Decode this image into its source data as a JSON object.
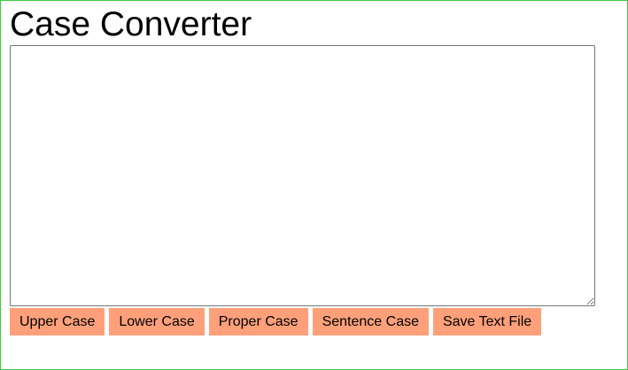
{
  "page": {
    "title": "Case Converter"
  },
  "editor": {
    "value": ""
  },
  "buttons": {
    "upper_case": "Upper Case",
    "lower_case": "Lower Case",
    "proper_case": "Proper Case",
    "sentence_case": "Sentence Case",
    "save_text_file": "Save Text File"
  },
  "colors": {
    "frame_border": "#3ec93e",
    "button_background": "#ffa07a",
    "text": "#000000"
  }
}
